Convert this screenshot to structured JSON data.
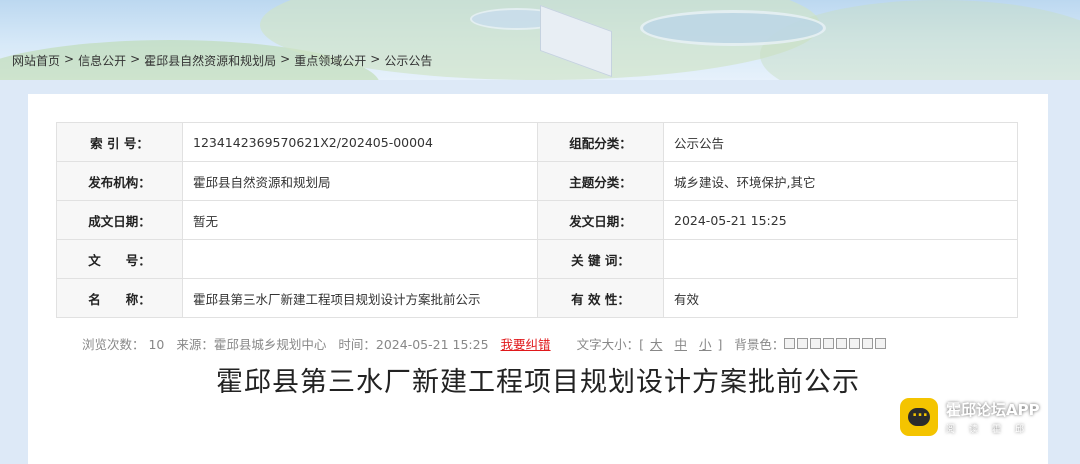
{
  "breadcrumb": {
    "items": [
      "网站首页",
      "信息公开",
      "霍邱县自然资源和规划局",
      "重点领域公开",
      "公示公告"
    ],
    "sep": ">"
  },
  "meta": {
    "index_label": "索 引 号：",
    "index_value": "1234142369570621X2/202405-00004",
    "category_label": "组配分类：",
    "category_value": "公示公告",
    "publisher_label": "发布机构：",
    "publisher_value": "霍邱县自然资源和规划局",
    "topic_label": "主题分类：",
    "topic_value": "城乡建设、环境保护,其它",
    "created_label": "成文日期：",
    "created_value": "暂无",
    "issued_label": "发文日期：",
    "issued_value": "2024-05-21 15:25",
    "docno_label": "文　　号：",
    "docno_value": "",
    "keywords_label": "关 键 词：",
    "keywords_value": "",
    "name_label": "名　　称：",
    "name_value": "霍邱县第三水厂新建工程项目规划设计方案批前公示",
    "validity_label": "有 效 性：",
    "validity_value": "有效"
  },
  "article": {
    "title": "霍邱县第三水厂新建工程项目规划设计方案批前公示",
    "views": "浏览次数： 10",
    "source": "来源：霍邱县城乡规划中心",
    "time": "时间：2024-05-21 15:25",
    "error_link": "我要纠错",
    "font_size_label": "文字大小：[",
    "font_large": "大",
    "font_medium": "中",
    "font_small": "小",
    "font_size_end": "]",
    "bg_label": "背景色："
  },
  "watermark": {
    "line1": "霍邱论坛APP",
    "line2": "阅读霍邱"
  }
}
